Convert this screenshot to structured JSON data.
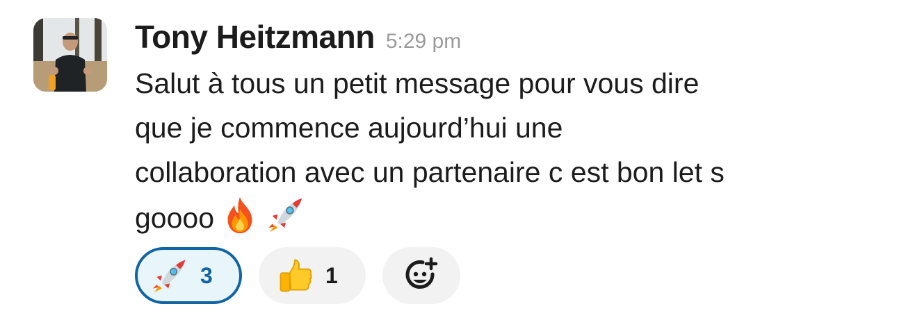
{
  "message": {
    "author": "Tony Heitzmann",
    "timestamp": "5:29 pm",
    "lines": [
      "Salut à tous un petit message pour vous dire",
      "que je commence aujourd’hui une",
      "collaboration avec un partenaire c est bon let s",
      "goooo"
    ],
    "inline_emojis": [
      "fire-emoji",
      "rocket-emoji"
    ]
  },
  "reactions": [
    {
      "emoji": "rocket-emoji",
      "count": "3",
      "selected": true
    },
    {
      "emoji": "thumbs-up-emoji",
      "count": "1",
      "selected": false
    },
    {
      "emoji": "add-reaction-icon"
    }
  ],
  "colors": {
    "accent": "#1264a3",
    "selected_bg": "#e8f5fa",
    "pill_bg": "#f2f2f2",
    "timestamp": "#9a9a9b",
    "text": "#1d1c1d"
  }
}
